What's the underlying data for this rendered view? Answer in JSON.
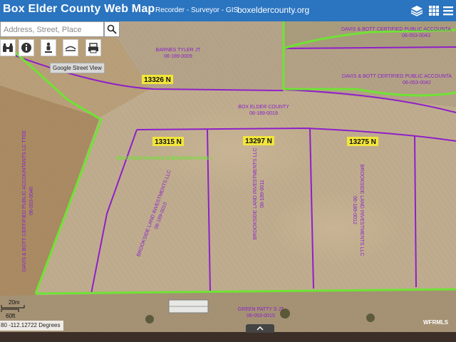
{
  "header": {
    "title": "Box Elder County Web Map",
    "subtitle": "Recorder - Surveyor - GIS",
    "site": "boxeldercounty.org",
    "buttons": [
      "layers-icon",
      "grid-icon",
      "menu-icon"
    ]
  },
  "search": {
    "placeholder": "Address, Street, Place"
  },
  "toolbar": {
    "tools": [
      "binoculars-icon",
      "info-icon",
      "pegman-icon",
      "measure-icon",
      "print-icon"
    ],
    "tooltip": "Google Street View"
  },
  "parcels": [
    {
      "owner": "BARNES TYLER JT",
      "id": "06-189-0009"
    },
    {
      "owner": "DAVIS & BOTT CERTIFIED PUBLIC ACCOUNTA",
      "id": "06-053-0043"
    },
    {
      "owner": "DAVIS & BOTT CERTIFIED PUBLIC ACCOUNTA",
      "id": "06-053-0042"
    },
    {
      "owner": "BOX ELDER COUNTY",
      "id": "06-189-0019"
    },
    {
      "owner": "DAVIS & BOTT CERTIFIED PUBLIC ACCOUNTANTS LC TTEE",
      "id": "06-053-0046"
    },
    {
      "owner": "BROOKSIDE LAND INVESTMENTS LLC",
      "id": "06-189-0010"
    },
    {
      "owner": "BROOKSIDE LAND INVESTMENTS LLC",
      "id": "06-189-0011"
    },
    {
      "owner": "BROOKSIDE LAND INVESTMENTS LLC",
      "id": "06-189-0012"
    },
    {
      "owner": "GREEN PATTY S JT",
      "id": "06-053-0015"
    }
  ],
  "addresses": [
    "13326 N",
    "13315 N",
    "13297 N",
    "13275 N"
  ],
  "subdivision": "BROOKSIDE RANCHES SUBDIVISION PHASE 1",
  "scale": {
    "meters": "20m",
    "feet": "60ft"
  },
  "coordinates": "80 -112.12722 Degrees",
  "watermark": "WFRMLS",
  "colors": {
    "header": "#2a74c0",
    "parcel_line": "#8f1fc9",
    "subdivision_line": "#6fe334",
    "address_label": "#f2e63a",
    "parcel_label": "#8a22c9"
  }
}
